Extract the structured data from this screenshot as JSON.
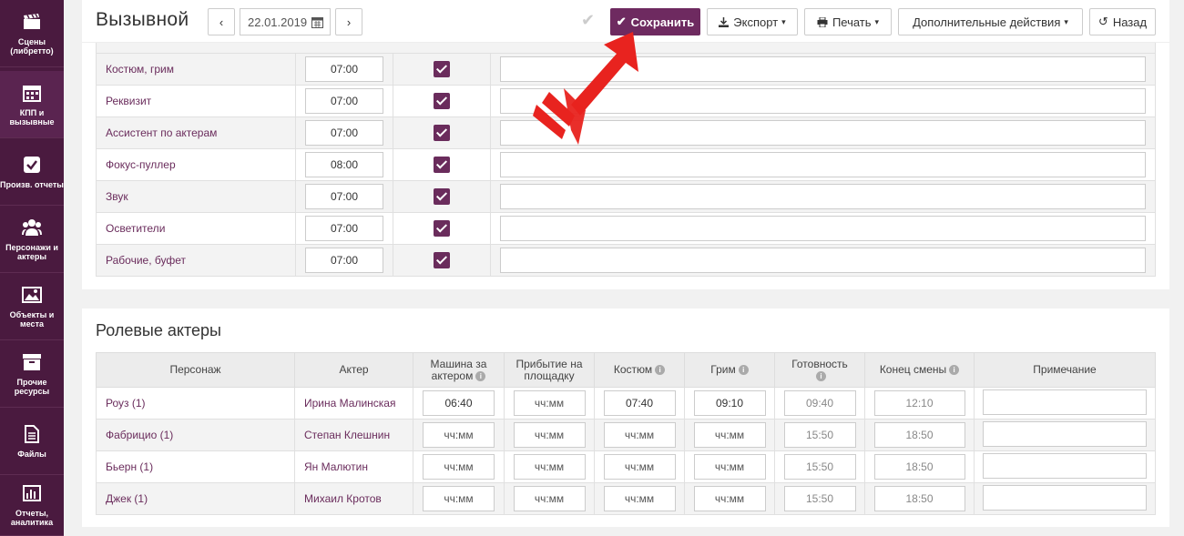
{
  "sidebar": {
    "items": [
      {
        "label": "Сцены (либретто)",
        "icon": "clapperboard-icon"
      },
      {
        "label": "КПП и вызывные",
        "icon": "calendar-icon"
      },
      {
        "label": "Произв. отчеты",
        "icon": "checkbox-icon"
      },
      {
        "label": "Персонажи и актеры",
        "icon": "people-icon"
      },
      {
        "label": "Объекты и места",
        "icon": "image-icon"
      },
      {
        "label": "Прочие ресурсы",
        "icon": "box-icon"
      },
      {
        "label": "Файлы",
        "icon": "file-icon"
      },
      {
        "label": "Отчеты, аналитика",
        "icon": "bar-chart-icon"
      }
    ]
  },
  "header": {
    "title": "Вызывной",
    "date": "22.01.2019",
    "save_label": "Сохранить",
    "export_label": "Экспорт",
    "print_label": "Печать",
    "more_label": "Дополнительные действия",
    "back_label": "Назад"
  },
  "crew": {
    "rows": [
      {
        "name": "Костюм, грим",
        "time": "07:00",
        "checked": true
      },
      {
        "name": "Реквизит",
        "time": "07:00",
        "checked": true
      },
      {
        "name": "Ассистент по актерам",
        "time": "07:00",
        "checked": true
      },
      {
        "name": "Фокус-пуллер",
        "time": "08:00",
        "checked": true
      },
      {
        "name": "Звук",
        "time": "07:00",
        "checked": true
      },
      {
        "name": "Осветители",
        "time": "07:00",
        "checked": true
      },
      {
        "name": "Рабочие, буфет",
        "time": "07:00",
        "checked": true
      }
    ]
  },
  "actors": {
    "title": "Ролевые актеры",
    "columns": {
      "person": "Персонаж",
      "actor": "Актер",
      "car": "Машина за актером",
      "arrival": "Прибытие на площадку",
      "costume": "Костюм",
      "makeup": "Грим",
      "ready": "Готовность",
      "end": "Конец смены",
      "note": "Примечание"
    },
    "placeholder": "чч:мм",
    "rows": [
      {
        "person": "Роуз (1)",
        "actor": "Ирина Малинская",
        "car": "06:40",
        "arrival": "чч:мм",
        "costume": "07:40",
        "makeup": "09:10",
        "ready": "09:40",
        "end": "12:10"
      },
      {
        "person": "Фабрицио (1)",
        "actor": "Степан Клешнин",
        "car": "чч:мм",
        "arrival": "чч:мм",
        "costume": "чч:мм",
        "makeup": "чч:мм",
        "ready": "15:50",
        "end": "18:50"
      },
      {
        "person": "Бьерн (1)",
        "actor": "Ян Малютин",
        "car": "чч:мм",
        "arrival": "чч:мм",
        "costume": "чч:мм",
        "makeup": "чч:мм",
        "ready": "15:50",
        "end": "18:50"
      },
      {
        "person": "Джек (1)",
        "actor": "Михаил Кротов",
        "car": "чч:мм",
        "arrival": "чч:мм",
        "costume": "чч:мм",
        "makeup": "чч:мм",
        "ready": "15:50",
        "end": "18:50"
      }
    ]
  },
  "colors": {
    "brand": "#6e2a60",
    "sidebar": "#4a1a3f",
    "annotation": "#e8231f"
  }
}
